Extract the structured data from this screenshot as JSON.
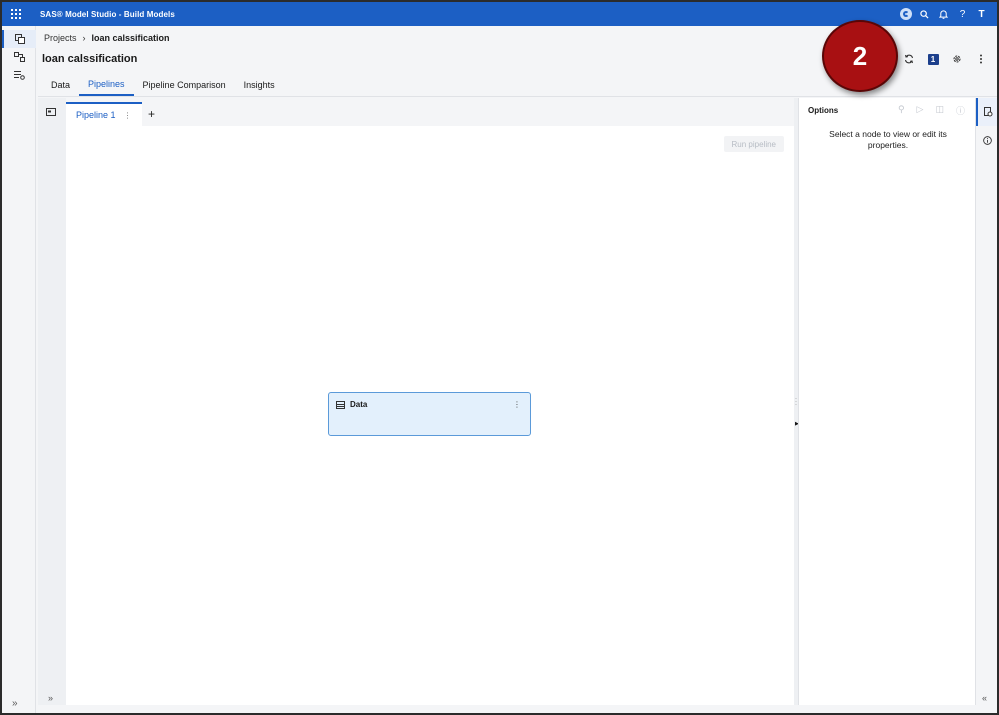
{
  "topbar": {
    "title": "SAS® Model Studio - Build Models",
    "help_label": "?",
    "user_initial": "T"
  },
  "breadcrumb": {
    "root": "Projects",
    "separator": "›",
    "current": "loan calssification"
  },
  "page": {
    "title": "loan calssification",
    "badge_count": "1"
  },
  "tabs": [
    "Data",
    "Pipelines",
    "Pipeline Comparison",
    "Insights"
  ],
  "active_tab": "Pipelines",
  "pipeline": {
    "tab_label": "Pipeline 1",
    "add_label": "+",
    "run_label": "Run pipeline",
    "node_label": "Data"
  },
  "options_panel": {
    "title": "Options",
    "empty_message": "Select a node to view or edit its properties."
  },
  "marker": {
    "label": "2"
  },
  "colors": {
    "brand": "#1c5fc4",
    "node_fill": "#e3f0fc",
    "node_border": "#5b9ad9",
    "marker": "#a81012"
  }
}
